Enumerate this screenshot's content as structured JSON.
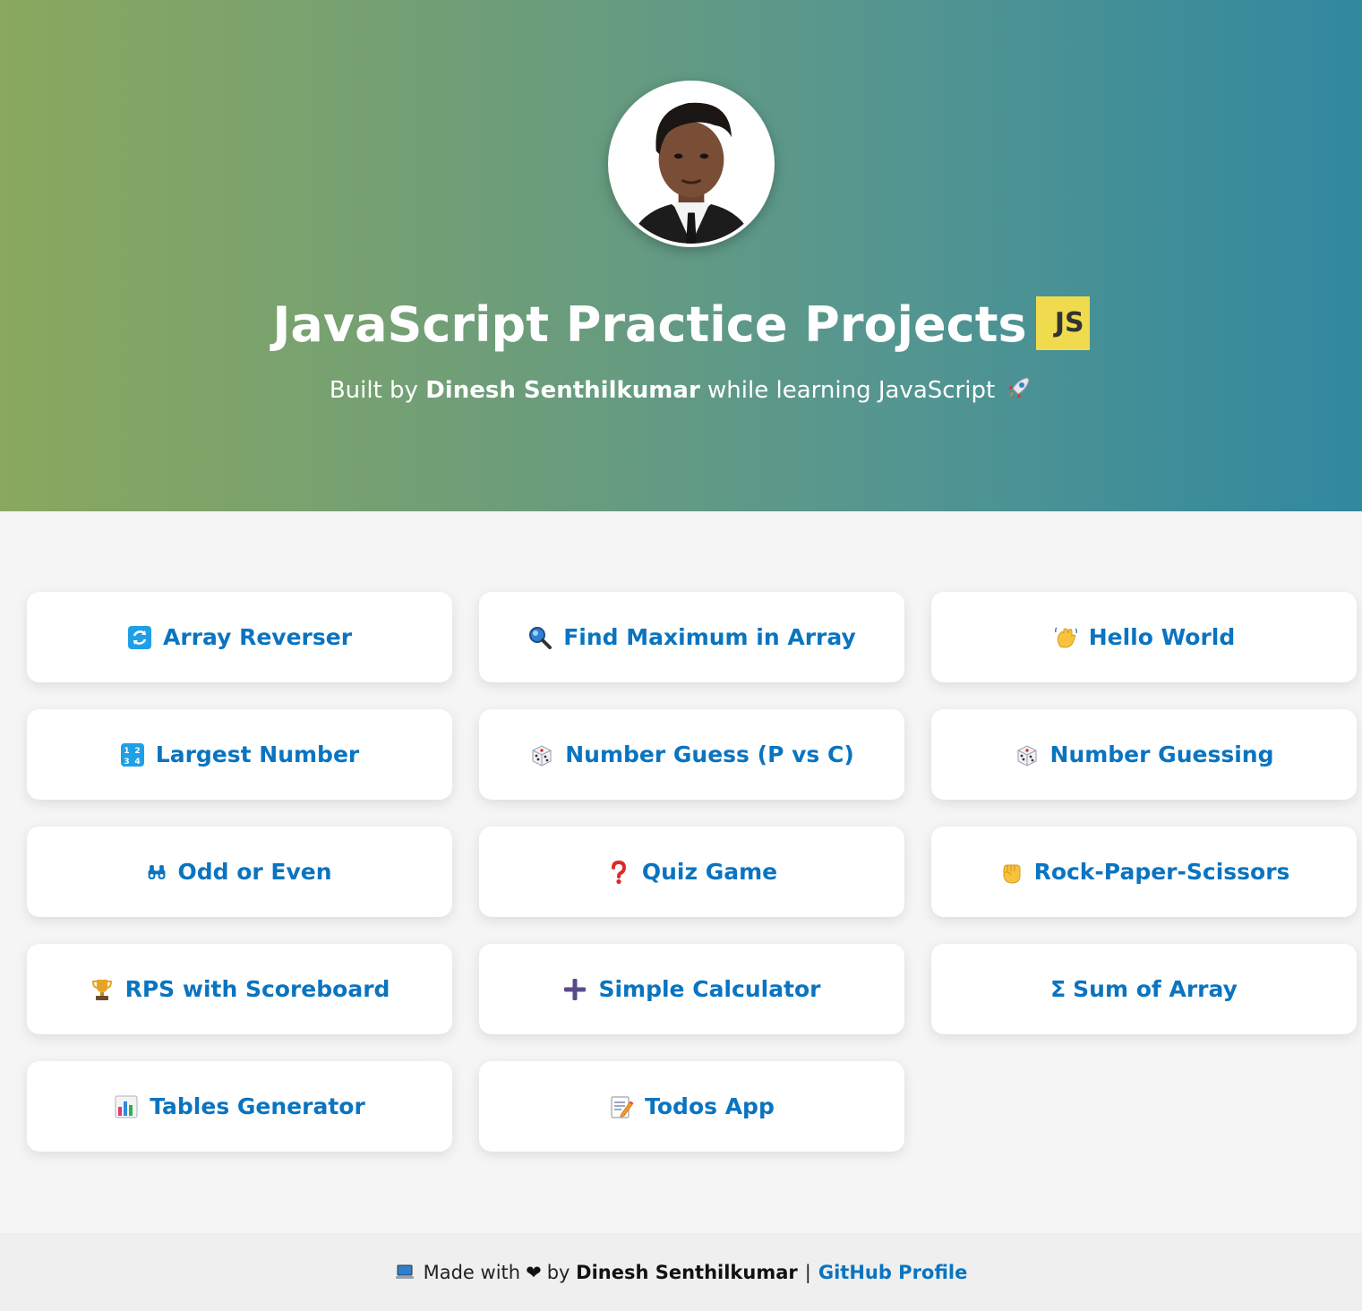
{
  "hero": {
    "title": "JavaScript Practice Projects",
    "badge": "JS",
    "subtitle_prefix": "Built by",
    "author": "Dinesh Senthilkumar",
    "subtitle_suffix": "while learning JavaScript"
  },
  "projects": [
    {
      "label": "Array Reverser",
      "icon": "repeat-arrows-icon"
    },
    {
      "label": "Find Maximum in Array",
      "icon": "magnifier-icon"
    },
    {
      "label": "Hello World",
      "icon": "waving-hand-icon"
    },
    {
      "label": "Largest Number",
      "icon": "numbers-1234-icon"
    },
    {
      "label": "Number Guess (P vs C)",
      "icon": "dice-icon"
    },
    {
      "label": "Number Guessing",
      "icon": "dice-icon"
    },
    {
      "label": "Odd or Even",
      "icon": "binoculars-icon"
    },
    {
      "label": "Quiz Game",
      "icon": "question-mark-icon"
    },
    {
      "label": "Rock-Paper-Scissors",
      "icon": "raised-fist-icon"
    },
    {
      "label": "RPS with Scoreboard",
      "icon": "trophy-icon"
    },
    {
      "label": "Simple Calculator",
      "icon": "plus-icon"
    },
    {
      "label": "Sum of Array",
      "icon": "sigma"
    },
    {
      "label": "Tables Generator",
      "icon": "bar-chart-icon"
    },
    {
      "label": "Todos App",
      "icon": "memo-icon"
    }
  ],
  "footer": {
    "made_with": "Made with",
    "by": "by",
    "author": "Dinesh Senthilkumar",
    "separator": "|",
    "github_label": "GitHub Profile"
  },
  "colors": {
    "accent": "#0a74c0",
    "js_badge": "#f0db4f"
  }
}
